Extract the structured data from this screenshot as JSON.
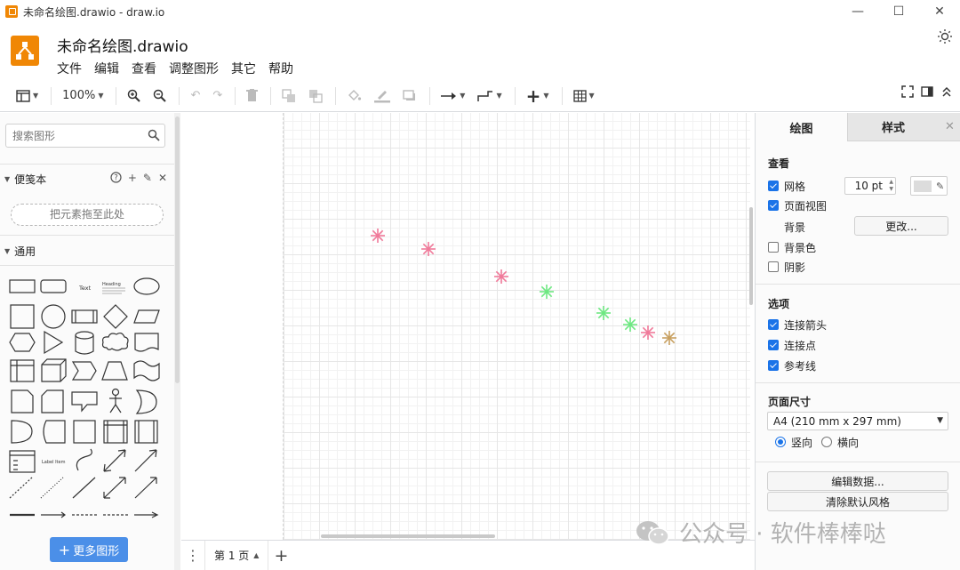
{
  "window": {
    "title": "未命名绘图.drawio - draw.io",
    "min_icon": "minimize-icon",
    "max_icon": "maximize-icon",
    "close_icon": "close-icon"
  },
  "header": {
    "file_title": "未命名绘图.drawio",
    "menu": [
      "文件",
      "编辑",
      "查看",
      "调整图形",
      "其它",
      "帮助"
    ]
  },
  "toolbar": {
    "zoom": "100%"
  },
  "sidebar": {
    "search_placeholder": "搜索图形",
    "scratchpad_title": "便笺本",
    "dropzone_text": "把元素拖至此处",
    "general_title": "通用",
    "more_shapes": "更多图形",
    "shape_text_label": "Text",
    "shape_heading_label": "Heading",
    "shape_list_label": "Label Item"
  },
  "canvas": {
    "stars": [
      {
        "color": "#f07a9a"
      },
      {
        "color": "#f07a9a"
      },
      {
        "color": "#f07a9a"
      },
      {
        "color": "#6ee882"
      },
      {
        "color": "#6ee882"
      },
      {
        "color": "#6ee882"
      },
      {
        "color": "#f07a9a"
      },
      {
        "color": "#c8a060"
      }
    ]
  },
  "pagebar": {
    "page_tab": "第 1 页"
  },
  "right_panel": {
    "tab_diagram": "绘图",
    "tab_style": "样式",
    "view_title": "查看",
    "grid_label": "网格",
    "grid_size": "10 pt",
    "page_view_label": "页面视图",
    "background_label": "背景",
    "change_button": "更改...",
    "bg_color_label": "背景色",
    "shadow_label": "阴影",
    "options_title": "选项",
    "connection_arrows": "连接箭头",
    "connection_points": "连接点",
    "guides": "参考线",
    "page_size_title": "页面尺寸",
    "page_size_value": "A4 (210 mm x 297 mm)",
    "portrait": "竖向",
    "landscape": "横向",
    "edit_data": "编辑数据...",
    "clear_style": "清除默认风格"
  },
  "watermark": {
    "text": "公众号 · 软件棒棒哒"
  },
  "colors": {
    "accent": "#f08705",
    "primary_button": "#4b8fe8",
    "checkbox": "#1a73e8"
  }
}
